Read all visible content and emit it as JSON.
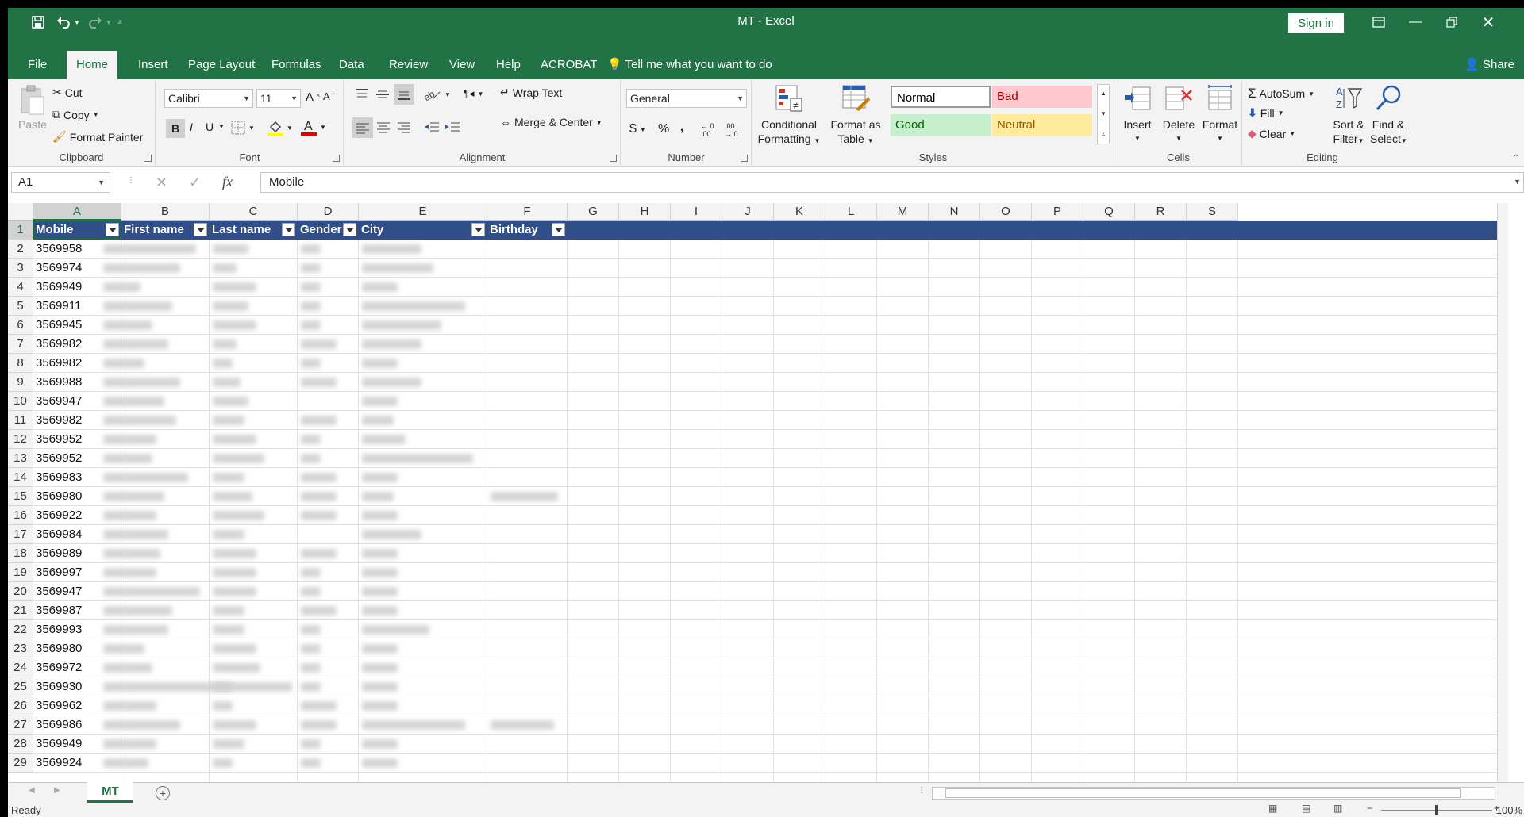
{
  "window": {
    "title": "MT  -  Excel",
    "sign_in": "Sign in",
    "share": "Share"
  },
  "tabs": [
    "File",
    "Home",
    "Insert",
    "Page Layout",
    "Formulas",
    "Data",
    "Review",
    "View",
    "Help",
    "ACROBAT"
  ],
  "active_tab": "Home",
  "tell_me": "Tell me what you want to do",
  "ribbon": {
    "clipboard": {
      "label": "Clipboard",
      "paste": "Paste",
      "cut": "Cut",
      "copy": "Copy",
      "format_painter": "Format Painter"
    },
    "font": {
      "label": "Font",
      "name": "Calibri",
      "size": "11",
      "bold": "B",
      "italic": "I",
      "underline": "U"
    },
    "alignment": {
      "label": "Alignment",
      "wrap_text": "Wrap Text",
      "merge_center": "Merge & Center"
    },
    "number": {
      "label": "Number",
      "format": "General",
      "currency": "$",
      "percent": "%",
      "comma": ","
    },
    "styles": {
      "label": "Styles",
      "conditional": "Conditional",
      "formatting": "Formatting",
      "format_as": "Format as",
      "table": "Table",
      "normal": "Normal",
      "bad": "Bad",
      "good": "Good",
      "neutral": "Neutral"
    },
    "cells": {
      "label": "Cells",
      "insert": "Insert",
      "delete": "Delete",
      "format": "Format"
    },
    "editing": {
      "label": "Editing",
      "autosum": "AutoSum",
      "fill": "Fill",
      "clear": "Clear",
      "sort_filter_1": "Sort &",
      "sort_filter_2": "Filter",
      "find_select_1": "Find &",
      "find_select_2": "Select"
    }
  },
  "formula_bar": {
    "name_box": "A1",
    "fx": "fx",
    "value": "Mobile"
  },
  "columns": [
    "A",
    "B",
    "C",
    "D",
    "E",
    "F",
    "G",
    "H",
    "I",
    "J",
    "K",
    "L",
    "M",
    "N",
    "O",
    "P",
    "Q",
    "R",
    "S"
  ],
  "selected_column": "A",
  "headers": [
    "Mobile",
    "First name",
    "Last name",
    "Gender",
    "City",
    "Birthday"
  ],
  "rows": [
    "1",
    "2",
    "3",
    "4",
    "5",
    "6",
    "7",
    "8",
    "9",
    "10",
    "11",
    "12",
    "13",
    "14",
    "15",
    "16",
    "17",
    "18",
    "19",
    "20",
    "21",
    "22",
    "23",
    "24",
    "25",
    "26",
    "27",
    "28",
    "29"
  ],
  "mobile_values": [
    "3569958",
    "3569974",
    "3569949",
    "3569911",
    "3569945",
    "3569982",
    "3569982",
    "3569988",
    "3569947",
    "3569982",
    "3569952",
    "3569952",
    "3569983",
    "3569980",
    "3569922",
    "3569984",
    "3569989",
    "3569997",
    "3569947",
    "3569987",
    "3569993",
    "3569980",
    "3569972",
    "3569930",
    "3569962",
    "3569986",
    "3569949",
    "3569924"
  ],
  "sheet": {
    "name": "MT"
  },
  "status": {
    "ready": "Ready",
    "zoom": "100%"
  },
  "colors": {
    "excel_green": "#217346",
    "table_header": "#2f4e8a"
  }
}
